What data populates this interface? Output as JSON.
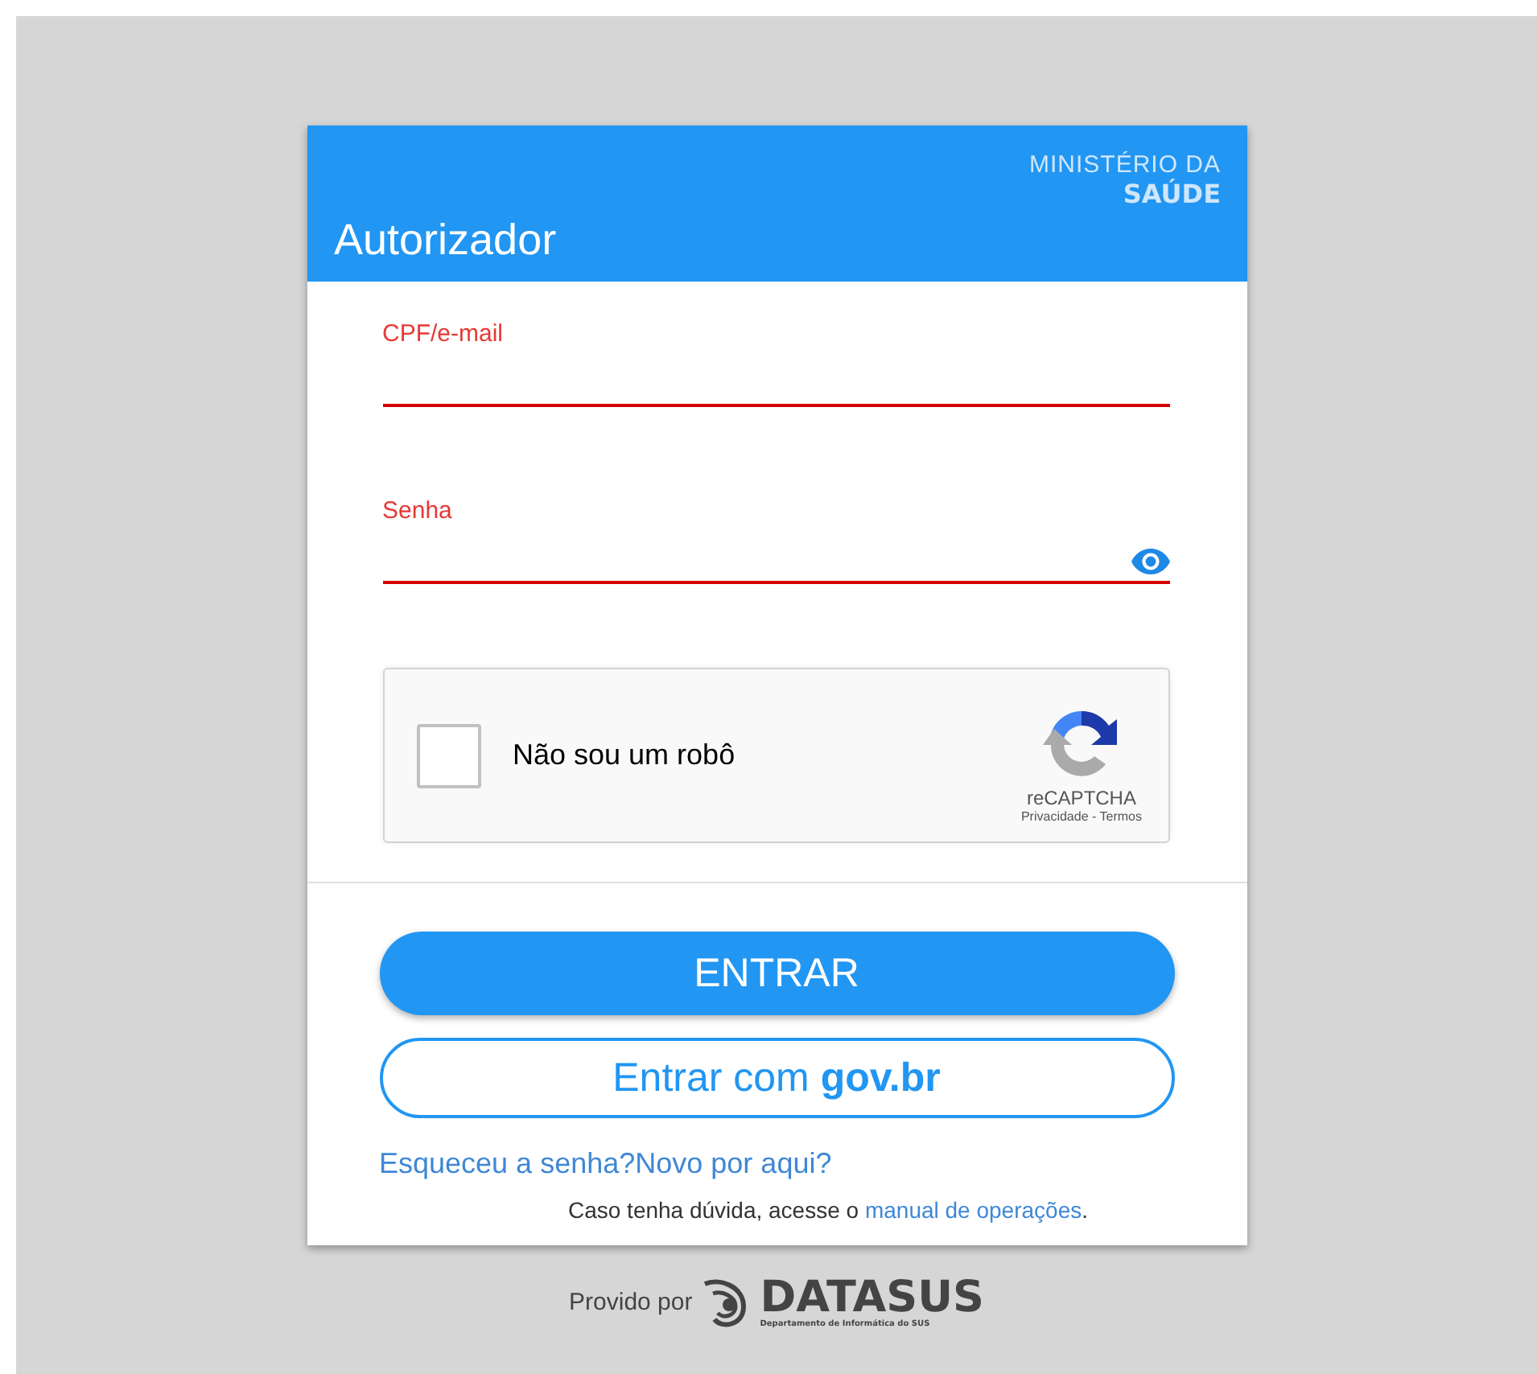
{
  "header": {
    "title": "Autorizador",
    "ministry_line1": "MINISTÉRIO DA",
    "ministry_line2": "SAÚDE"
  },
  "fields": [
    {
      "kind": "text",
      "label": "CPF/e-mail",
      "invalid": true
    },
    {
      "kind": "password",
      "label": "Senha",
      "invalid": true
    }
  ],
  "captcha": {
    "label": "Não sou um robô",
    "checked": false,
    "brand": "reCAPTCHA",
    "privacy": "Privacidade",
    "separator": "-",
    "terms": "Termos"
  },
  "buttons": [
    {
      "kind": "primary",
      "label": "ENTRAR"
    },
    {
      "kind": "outline",
      "label": "Entrar com **gov.br**"
    }
  ],
  "links": [
    "Esqueceu a senha?",
    "Novo por aqui?"
  ],
  "help": {
    "text": "Caso tenha dúvida, acesse o",
    "link": "manual de operações",
    "end": "."
  },
  "footer": {
    "prefix": "Provido por",
    "brand": "DATASUS",
    "subtitle": "Departamento de Informática do SUS"
  }
}
